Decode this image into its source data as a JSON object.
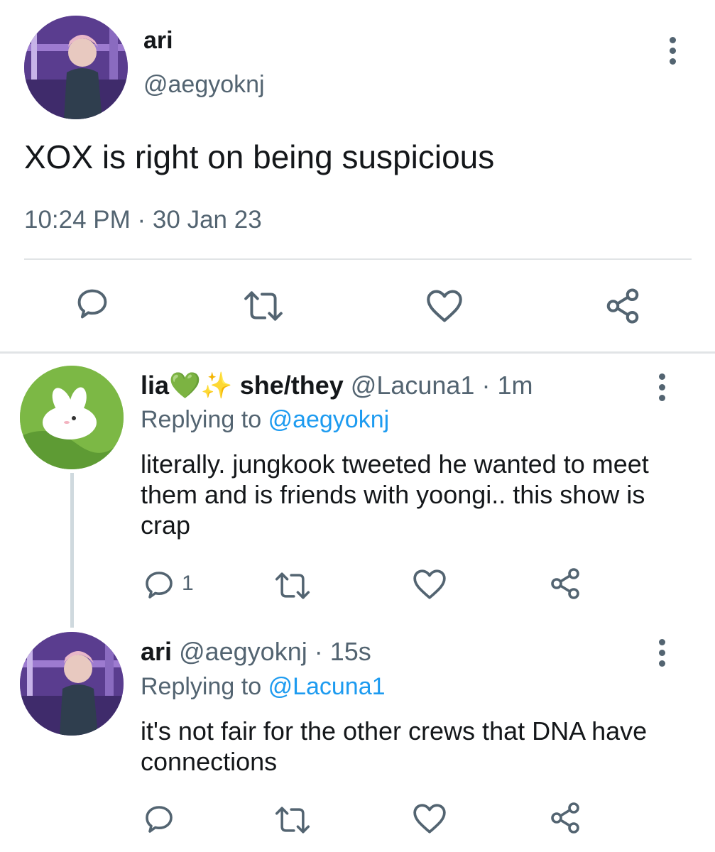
{
  "main_tweet": {
    "author_name": "ari",
    "author_handle": "@aegyoknj",
    "text": "XOX is right on being suspicious",
    "timestamp": "10:24 PM · 30 Jan 23"
  },
  "replies": [
    {
      "author_name": "lia",
      "name_emoji": "💚✨",
      "pronouns": "she/they",
      "author_handle": "@Lacuna1",
      "time": "· 1m",
      "replying_label": "Replying to",
      "replying_to": "@aegyoknj",
      "text": "literally. jungkook tweeted he wanted to meet them and is friends with yoongi.. this show is crap",
      "reply_count": "1"
    },
    {
      "author_name": "ari",
      "author_handle": "@aegyoknj",
      "time": "· 15s",
      "replying_label": "Replying to",
      "replying_to": "@Lacuna1",
      "text": "it's not fair for the other crews that DNA have connections"
    }
  ],
  "colors": {
    "secondary_text": "#536471",
    "link": "#1d9bf0",
    "divider": "#e1e4e6",
    "icon": "#536471"
  },
  "icons": {
    "reply": "speech-bubble-icon",
    "retweet": "retweet-arrows-icon",
    "like": "heart-outline-icon",
    "share": "share-nodes-icon",
    "more": "vertical-ellipsis-icon"
  }
}
